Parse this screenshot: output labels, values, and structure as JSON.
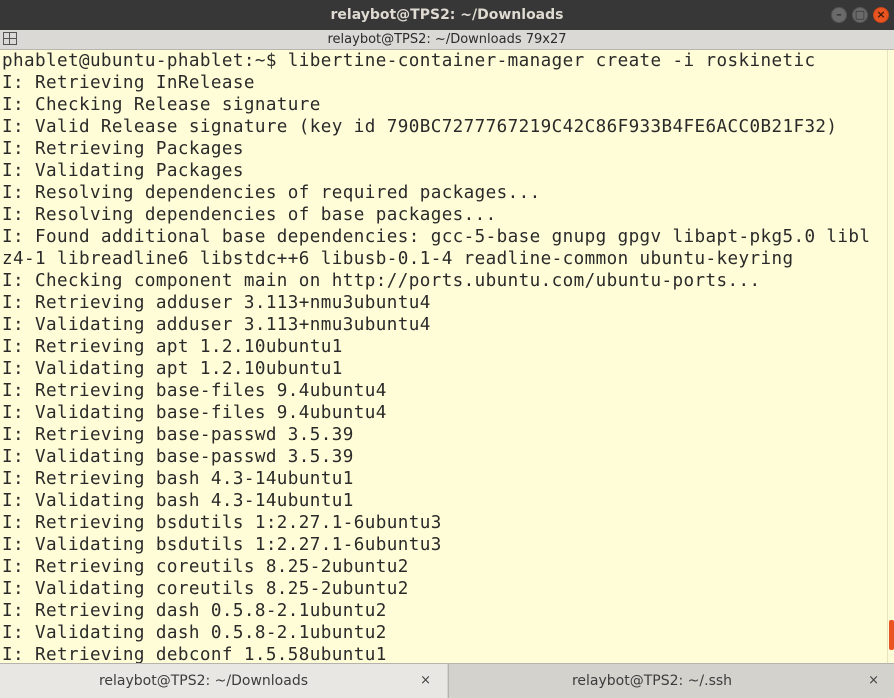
{
  "window": {
    "title": "relaybot@TPS2: ~/Downloads",
    "subtitle": "relaybot@TPS2: ~/Downloads 79x27"
  },
  "terminal": {
    "lines": [
      "phablet@ubuntu-phablet:~$ libertine-container-manager create -i roskinetic",
      "I: Retrieving InRelease",
      "I: Checking Release signature",
      "I: Valid Release signature (key id 790BC7277767219C42C86F933B4FE6ACC0B21F32)",
      "I: Retrieving Packages",
      "I: Validating Packages",
      "I: Resolving dependencies of required packages...",
      "I: Resolving dependencies of base packages...",
      "I: Found additional base dependencies: gcc-5-base gnupg gpgv libapt-pkg5.0 libl",
      "z4-1 libreadline6 libstdc++6 libusb-0.1-4 readline-common ubuntu-keyring",
      "I: Checking component main on http://ports.ubuntu.com/ubuntu-ports...",
      "I: Retrieving adduser 3.113+nmu3ubuntu4",
      "I: Validating adduser 3.113+nmu3ubuntu4",
      "I: Retrieving apt 1.2.10ubuntu1",
      "I: Validating apt 1.2.10ubuntu1",
      "I: Retrieving base-files 9.4ubuntu4",
      "I: Validating base-files 9.4ubuntu4",
      "I: Retrieving base-passwd 3.5.39",
      "I: Validating base-passwd 3.5.39",
      "I: Retrieving bash 4.3-14ubuntu1",
      "I: Validating bash 4.3-14ubuntu1",
      "I: Retrieving bsdutils 1:2.27.1-6ubuntu3",
      "I: Validating bsdutils 1:2.27.1-6ubuntu3",
      "I: Retrieving coreutils 8.25-2ubuntu2",
      "I: Validating coreutils 8.25-2ubuntu2",
      "I: Retrieving dash 0.5.8-2.1ubuntu2",
      "I: Validating dash 0.5.8-2.1ubuntu2",
      "I: Retrieving debconf 1.5.58ubuntu1"
    ]
  },
  "tabs": [
    {
      "label": "relaybot@TPS2: ~/Downloads",
      "close": "×",
      "active": true
    },
    {
      "label": "relaybot@TPS2: ~/.ssh",
      "close": "×",
      "active": false
    }
  ],
  "icons": {
    "minimize": "minimize-icon",
    "maximize": "maximize-icon",
    "close": "close-icon",
    "app_menu": "terminal-menu-icon"
  },
  "colors": {
    "terminal_bg": "#fffdd7",
    "titlebar_bg": "#373737",
    "accent": "#e95420"
  }
}
